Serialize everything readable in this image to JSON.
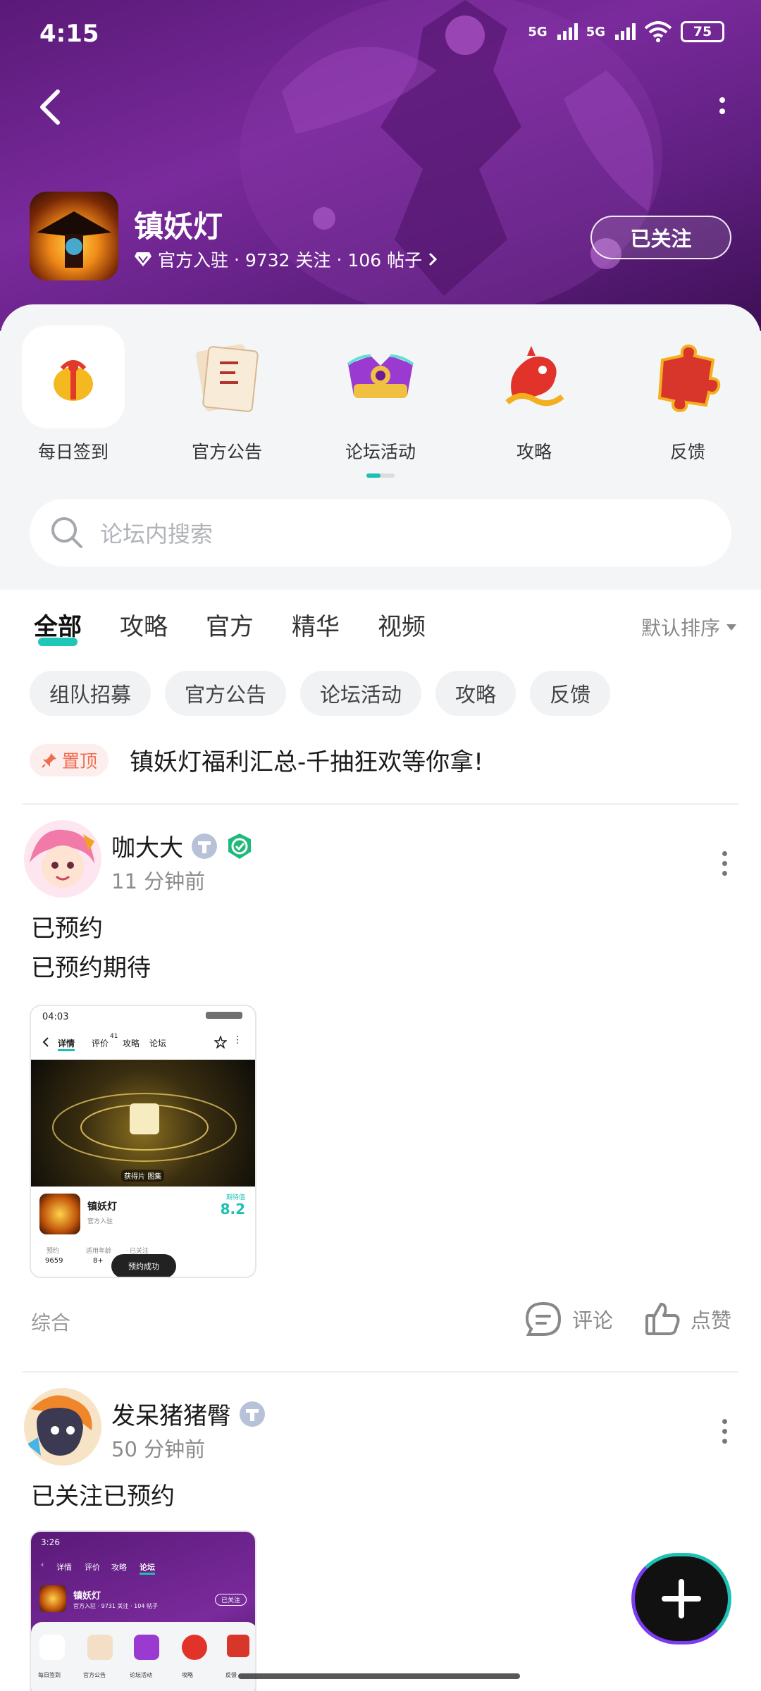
{
  "status": {
    "time": "4:15",
    "net1": "5G",
    "net2": "5G",
    "battery": "75"
  },
  "header": {
    "title": "镇妖灯",
    "official": "官方入驻",
    "sep": "·",
    "followers": "9732 关注",
    "posts": "106 帖子",
    "follow_label": "已关注"
  },
  "shortcuts": [
    {
      "label": "每日签到"
    },
    {
      "label": "官方公告"
    },
    {
      "label": "论坛活动"
    },
    {
      "label": "攻略"
    },
    {
      "label": "反馈"
    }
  ],
  "search": {
    "placeholder": "论坛内搜索"
  },
  "tabs": [
    "全部",
    "攻略",
    "官方",
    "精华",
    "视频"
  ],
  "sort_label": "默认排序",
  "chips": [
    "组队招募",
    "官方公告",
    "论坛活动",
    "攻略",
    "反馈"
  ],
  "pinned": {
    "badge": "置顶",
    "text": "镇妖灯福利汇总-千抽狂欢等你拿!"
  },
  "posts": [
    {
      "author": "咖大大",
      "time": "11 分钟前",
      "lines": [
        "已预约",
        "已预约期待"
      ],
      "tag": "综合",
      "comment": "评论",
      "like": "点赞",
      "shot": {
        "time": "04:03",
        "tabs": [
          "详情",
          "评价",
          "攻略",
          "论坛"
        ],
        "review_count": "41",
        "game": "镇妖灯",
        "official": "官方入驻",
        "score_label": "期待值",
        "score": "8.2",
        "overlay": "获得片",
        "overlay2": "图集",
        "stats": [
          {
            "label": "预约",
            "value": "9659"
          },
          {
            "label": "适用年龄",
            "value": "8+"
          },
          {
            "label": "已关注",
            "value": ""
          }
        ],
        "toast": "预约成功"
      }
    },
    {
      "author": "发呆猪猪臀",
      "time": "50 分钟前",
      "lines": [
        "已关注已预约"
      ],
      "shot": {
        "time": "3:26",
        "tabs": [
          "详情",
          "评价",
          "攻略",
          "论坛"
        ],
        "game": "镇妖灯",
        "meta": "官方入驻 · 9731 关注 · 104 帖子",
        "follow": "已关注",
        "sc": [
          "每日签到",
          "官方公告",
          "论坛活动",
          "攻略",
          "反馈"
        ]
      }
    }
  ],
  "colors": {
    "accent": "#1ec0b4",
    "header": "#6a2490",
    "pin": "#ef6c4d"
  }
}
